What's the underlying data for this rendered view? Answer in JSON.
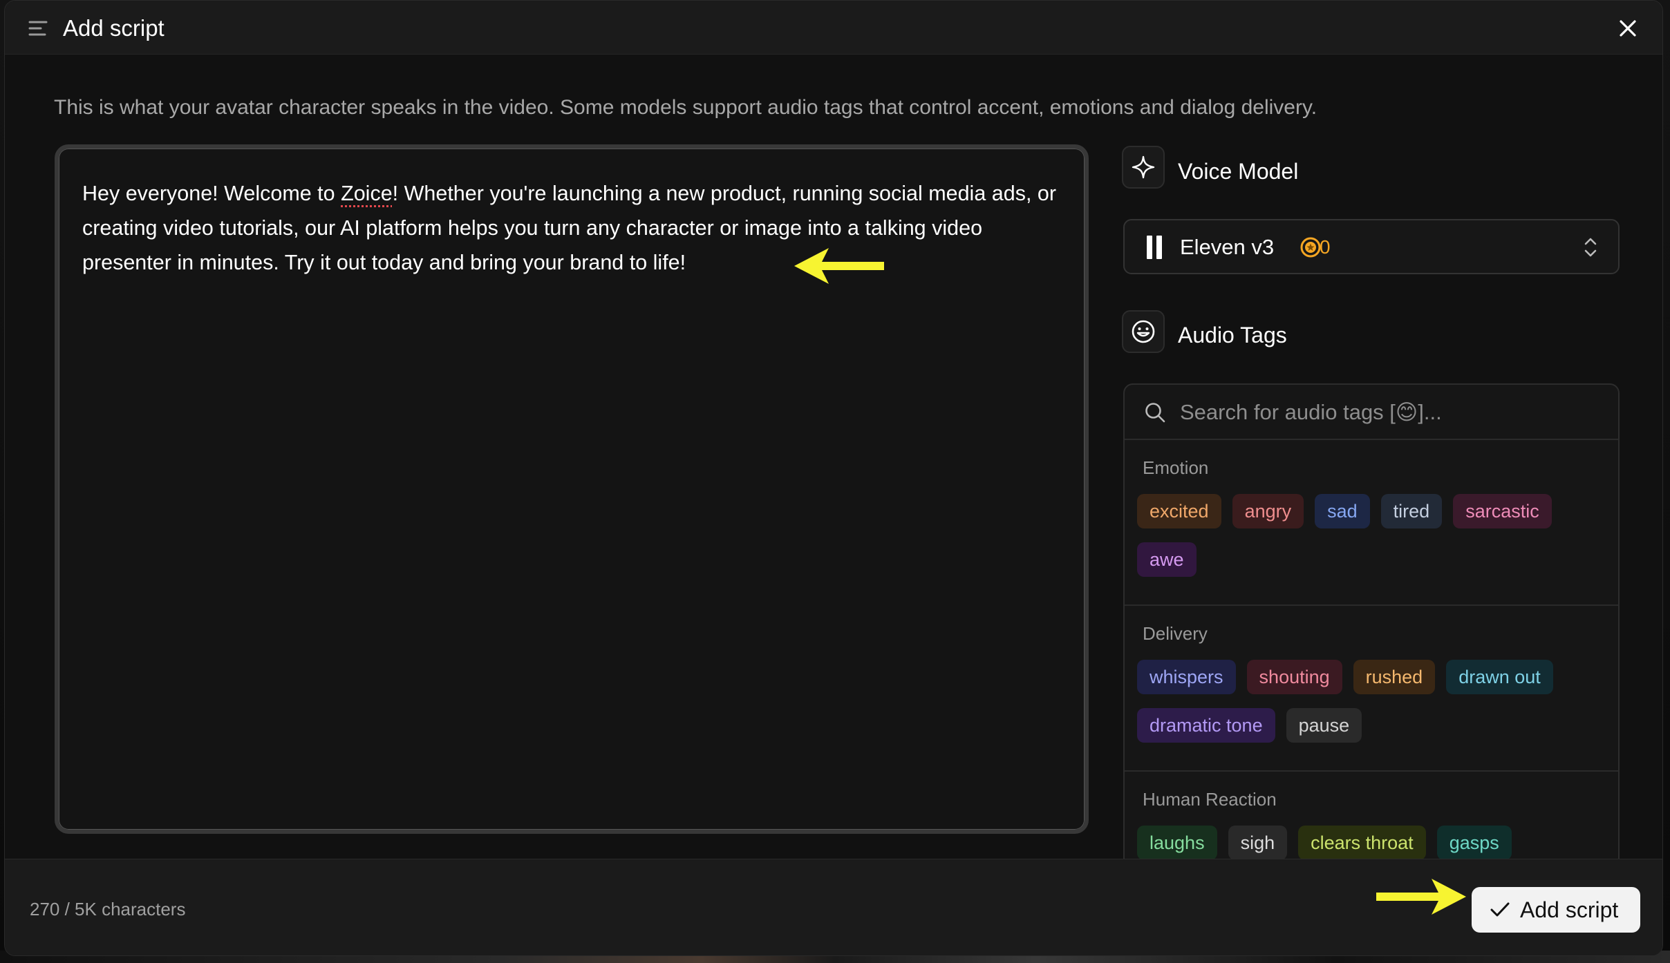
{
  "header": {
    "title": "Add script"
  },
  "description": "This is what your avatar character speaks in the video. Some models support audio tags that control accent, emotions and dialog delivery.",
  "script": {
    "text_before": "Hey everyone! Welcome to ",
    "misspelled_word": "Zoice",
    "text_after": "! Whether you're launching a new product, running social media ads, or creating video tutorials, our AI platform helps you turn any character or image into a talking video presenter in minutes. Try it out today and bring your brand to life!"
  },
  "voice_model": {
    "label": "Voice Model",
    "selected_model": "Eleven v3",
    "credits": "0",
    "credit_color": "#f5a623"
  },
  "audio_tags": {
    "label": "Audio Tags",
    "search_placeholder": "Search for audio tags [😊]...",
    "sections": [
      {
        "heading": "Emotion",
        "tags": [
          "excited",
          "angry",
          "sad",
          "tired",
          "sarcastic",
          "awe"
        ]
      },
      {
        "heading": "Delivery",
        "tags": [
          "whispers",
          "shouting",
          "rushed",
          "drawn out",
          "dramatic tone",
          "pause"
        ]
      },
      {
        "heading": "Human Reaction",
        "tags": [
          "laughs",
          "sigh",
          "clears throat",
          "gasps"
        ]
      }
    ]
  },
  "footer": {
    "char_count": "270 / 5K characters",
    "add_button_label": "Add script"
  },
  "icons": [
    "menu-icon",
    "close-icon",
    "sparkle-icon",
    "smiley-icon",
    "search-icon",
    "coin-icon",
    "chevron-updown-icon",
    "check-icon",
    "annotation-arrow"
  ],
  "colors": {
    "annotation_arrow": "#f7f431",
    "accent_credits": "#f5a623"
  }
}
